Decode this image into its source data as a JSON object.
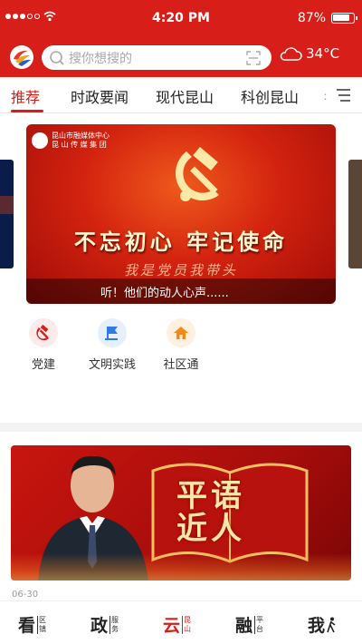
{
  "status_bar": {
    "time": "4:20 PM",
    "battery": "87%",
    "battery_level": 0.87
  },
  "header": {
    "search_placeholder": "搜你想搜的",
    "temperature": "34°C",
    "weather_icon": "cloud-icon",
    "scan_icon": "scan-icon"
  },
  "tabs": [
    {
      "label": "推荐",
      "active": true
    },
    {
      "label": "时政要闻",
      "active": false
    },
    {
      "label": "现代昆山",
      "active": false
    },
    {
      "label": "科创昆山",
      "active": false
    }
  ],
  "tabs_overflow": "：",
  "banner": {
    "org_line1": "昆山市融媒体中心",
    "org_line2": "昆 山 传 媒 集 团",
    "slogan": "不忘初心 牢记使命",
    "signature": "我是党员我带头",
    "caption": "听！他们的动人心声......"
  },
  "quick_entries": [
    {
      "label": "党建",
      "icon": "party-emblem-icon",
      "bg": "#fdeaea"
    },
    {
      "label": "文明实践",
      "icon": "flag-icon",
      "bg": "#e6f0fd"
    },
    {
      "label": "社区通",
      "icon": "house-icon",
      "bg": "#fff0e0"
    }
  ],
  "feature": {
    "title_line1": "平语",
    "title_line2": "近人",
    "date": "06-30"
  },
  "bottom_nav": [
    {
      "big": "看",
      "small": "区镇",
      "active": false
    },
    {
      "big": "政",
      "small": "服务",
      "active": false
    },
    {
      "big": "云",
      "small": "昆山",
      "active": true
    },
    {
      "big": "融",
      "small": "平台",
      "active": false
    },
    {
      "big": "我",
      "small": "",
      "active": false
    }
  ],
  "colors": {
    "brand_red": "#d81e19",
    "text_dark": "#222222",
    "muted": "#999999"
  }
}
